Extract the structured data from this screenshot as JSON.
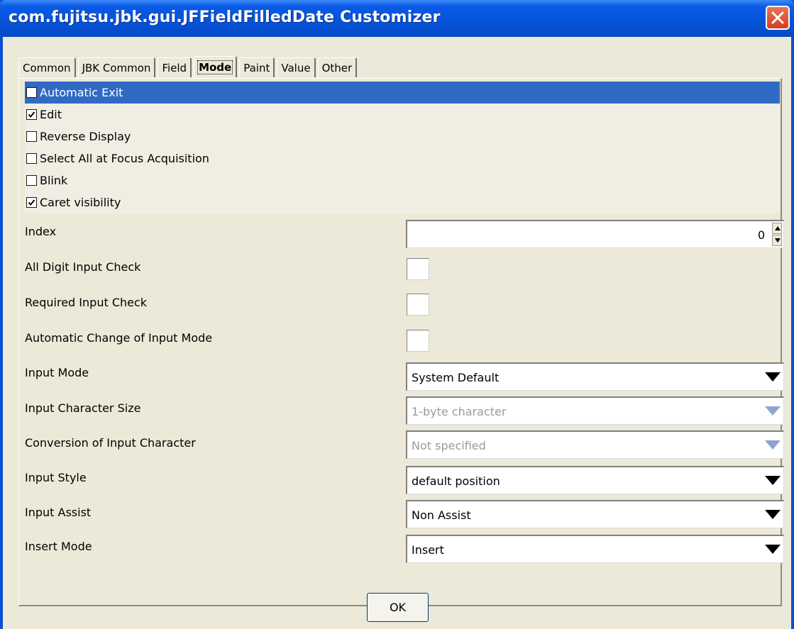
{
  "window": {
    "title": "com.fujitsu.jbk.gui.JFFieldFilledDate Customizer"
  },
  "tabs": [
    {
      "label": "Common"
    },
    {
      "label": "JBK Common"
    },
    {
      "label": "Field"
    },
    {
      "label": "Mode"
    },
    {
      "label": "Paint"
    },
    {
      "label": "Value"
    },
    {
      "label": "Other"
    }
  ],
  "active_tab": "Mode",
  "mode_options": [
    {
      "label": "Automatic Exit",
      "checked": false,
      "selected": true
    },
    {
      "label": "Edit",
      "checked": true,
      "selected": false
    },
    {
      "label": "Reverse Display",
      "checked": false,
      "selected": false
    },
    {
      "label": "Select All at Focus Acquisition",
      "checked": false,
      "selected": false
    },
    {
      "label": "Blink",
      "checked": false,
      "selected": false
    },
    {
      "label": "Caret visibility",
      "checked": true,
      "selected": false
    }
  ],
  "properties": {
    "index": {
      "label": "Index",
      "value": "0"
    },
    "all_digit": {
      "label": "All Digit Input Check",
      "checked": false
    },
    "required": {
      "label": "Required Input Check",
      "checked": false
    },
    "auto_change": {
      "label": "Automatic Change of Input Mode",
      "checked": false
    },
    "input_mode": {
      "label": "Input Mode",
      "value": "System Default",
      "enabled": true
    },
    "char_size": {
      "label": "Input Character Size",
      "value": "1-byte character",
      "enabled": false
    },
    "conversion": {
      "label": "Conversion of Input Character",
      "value": "Not specified",
      "enabled": false
    },
    "input_style": {
      "label": "Input Style",
      "value": "default position",
      "enabled": true
    },
    "input_assist": {
      "label": "Input Assist",
      "value": "Non Assist",
      "enabled": true
    },
    "insert_mode": {
      "label": "Insert Mode",
      "value": "Insert",
      "enabled": true
    }
  },
  "buttons": {
    "ok": "OK"
  },
  "colors": {
    "titlebar": "#0553d9",
    "selection": "#316ac5",
    "face": "#ece9d8",
    "close": "#d2401e"
  }
}
